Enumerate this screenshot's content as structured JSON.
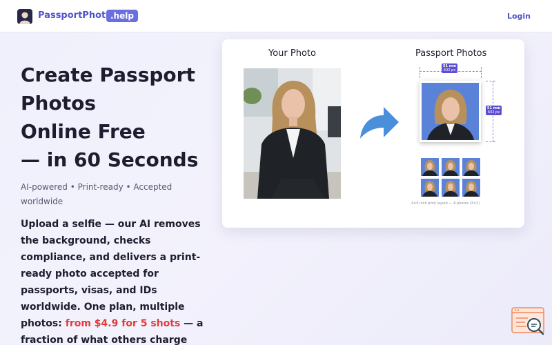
{
  "header": {
    "logo_text": "PassportPhoto",
    "logo_badge": ".help",
    "login_label": "Login"
  },
  "hero": {
    "title_lines": [
      "Create Passport",
      "Photos",
      "Online Free",
      "— in 60 Seconds"
    ],
    "tagline": "AI-powered  •  Print-ready  •  Accepted worldwide",
    "description_before": "Upload a selfie — our AI removes the background, checks compliance, and delivers a print-ready photo accepted for passports, visas, and IDs worldwide. One plan, multiple photos: ",
    "description_price": "from $4.9 for 5 shots",
    "description_after": " — a fraction of what others charge"
  },
  "card": {
    "your_photo_label": "Your Photo",
    "passport_label": "Passport Photos",
    "width_mm": "51 mm",
    "width_px": "602 px",
    "height_mm": "51 mm",
    "height_px": "602 px",
    "grid_caption": "4×6 inch print layout — 6 photos (3×2)"
  },
  "colors": {
    "brand": "#4f55c9",
    "badge": "#6a6fe0",
    "price": "#e03c3c",
    "arrow": "#4a8fd9",
    "photo_bg": "#5a82d9"
  },
  "icons": {
    "logo": "person-silhouette-icon",
    "arrow": "curved-arrow-right-icon",
    "help": "help-search-icon"
  }
}
